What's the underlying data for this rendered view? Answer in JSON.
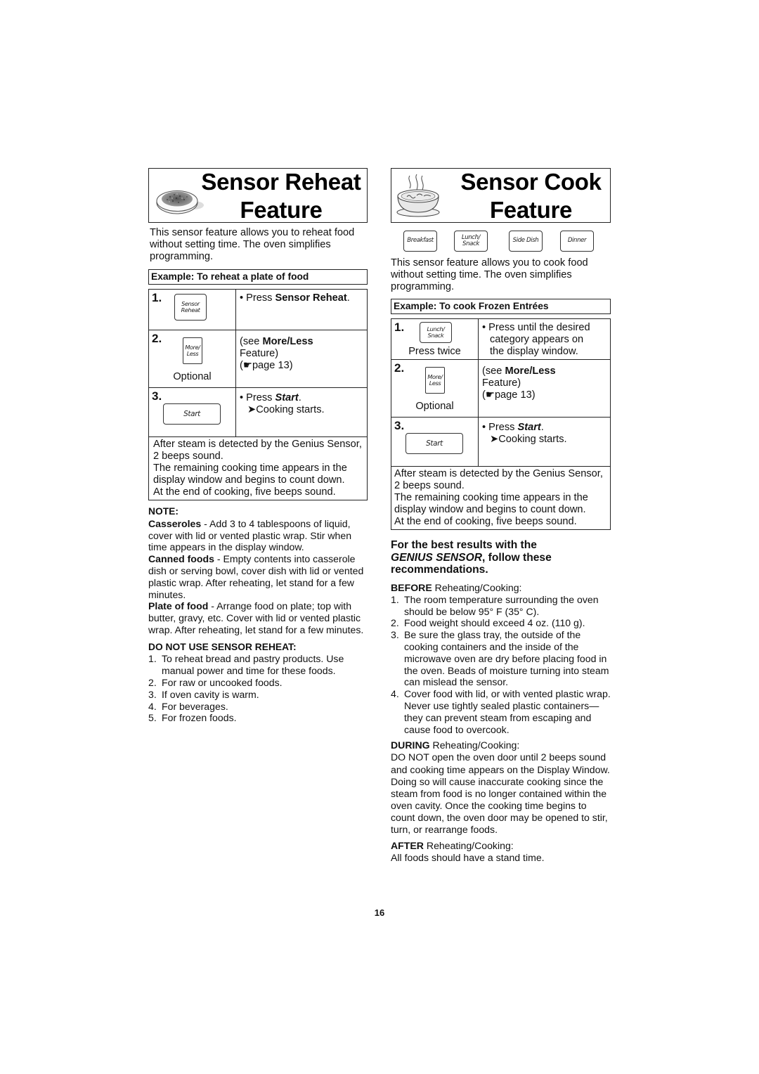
{
  "left": {
    "title_line1": "Sensor Reheat",
    "title_line2": "Feature",
    "title_art_icon": "plate-of-food-icon",
    "intro": "This sensor feature allows you to reheat food without setting time. The oven simplifies programming.",
    "example_title": "Example: To reheat a plate of food",
    "steps": [
      {
        "number": "1.",
        "pad_line1": "Sensor",
        "pad_line2": "Reheat",
        "sublabel": "",
        "text_prefix": "• Press ",
        "text_bold": "Sensor Reheat",
        "text_suffix": "."
      },
      {
        "number": "2.",
        "pad_line1": "More/",
        "pad_line2": "Less",
        "sublabel": "Optional",
        "text_prefix": "(see ",
        "text_bold": "More/Less",
        "text_line2": "Feature)",
        "text_line3": "(☛page 13)"
      },
      {
        "number": "3.",
        "pad_line1": "Start",
        "text_prefix": "• Press ",
        "text_bold": "Start",
        "text_suffix": ".",
        "text_line2": "➤Cooking starts."
      }
    ],
    "after_text": [
      "After steam is detected by the Genius Sensor, 2 beeps sound.",
      "The remaining cooking time appears in the display window and begins to count down.",
      "At the end of cooking, five beeps sound."
    ],
    "note": {
      "heading": "NOTE:",
      "items": [
        {
          "bold": "Casseroles",
          "text": " - Add 3 to 4 tablespoons of liquid, cover with lid or vented plastic wrap. Stir when time appears in the display window."
        },
        {
          "bold": "Canned foods",
          "text": " - Empty contents into casserole dish or serving bowl, cover dish with lid or vented plastic wrap. After reheating, let stand for a few minutes."
        },
        {
          "bold": "Plate of food",
          "text": " - Arrange food on plate; top with butter, gravy, etc. Cover with lid or vented plastic wrap. After reheating, let stand for a few minutes."
        }
      ]
    },
    "do_not_use": {
      "heading": "DO NOT USE SENSOR REHEAT:",
      "items": [
        {
          "n": "1.",
          "text": "To reheat bread and pastry products. Use manual power and time for these foods."
        },
        {
          "n": "2.",
          "text": "For raw or uncooked foods."
        },
        {
          "n": "3.",
          "text": "If oven cavity is warm."
        },
        {
          "n": "4.",
          "text": "For beverages."
        },
        {
          "n": "5.",
          "text": "For frozen foods."
        }
      ]
    }
  },
  "right": {
    "title_line1": "Sensor Cook",
    "title_line2": "Feature",
    "title_art_icon": "steaming-bowl-icon",
    "category_pads": [
      {
        "line1": "Breakfast",
        "line2": ""
      },
      {
        "line1": "Lunch/",
        "line2": "Snack"
      },
      {
        "line1": "Side Dish",
        "line2": ""
      },
      {
        "line1": "Dinner",
        "line2": ""
      }
    ],
    "intro": "This sensor feature allows you to cook food without setting time. The oven simplifies programming.",
    "example_title": "Example: To cook Frozen Entrées",
    "steps": [
      {
        "number": "1.",
        "pad_line1": "Lunch/",
        "pad_line2": "Snack",
        "sublabel": "Press twice",
        "text_prefix": "• Press until the desired",
        "text_line2": "category appears on",
        "text_line3": "the display window."
      },
      {
        "number": "2.",
        "pad_line1": "More/",
        "pad_line2": "Less",
        "sublabel": "Optional",
        "text_prefix": "(see ",
        "text_bold": "More/Less",
        "text_line2": "Feature)",
        "text_line3": "(☛page 13)"
      },
      {
        "number": "3.",
        "pad_line1": "Start",
        "text_prefix": "• Press ",
        "text_bold": "Start",
        "text_suffix": ".",
        "text_line2": "➤Cooking starts."
      }
    ],
    "after_text": [
      "After steam is detected by the Genius Sensor, 2 beeps sound.",
      "The remaining cooking time appears in the display window and begins to count down.",
      "At the end of cooking, five beeps sound."
    ],
    "best_results": {
      "line1": "For the best results with the",
      "italic": "GENIUS SENSOR",
      "rest": ", follow these recommendations."
    },
    "before": {
      "bold": "BEFORE",
      "label": " Reheating/Cooking:",
      "items": [
        {
          "n": "1.",
          "text": "The room temperature surrounding the oven should be below 95° F (35° C)."
        },
        {
          "n": "2.",
          "text": "Food weight should exceed 4 oz. (110 g)."
        },
        {
          "n": "3.",
          "text": "Be sure the glass tray, the outside of the cooking containers and the inside of the microwave oven are dry before placing food in the oven. Beads of moisture turning into steam can mislead the sensor."
        },
        {
          "n": "4.",
          "text": "Cover food with lid, or with vented plastic wrap. Never use tightly sealed plastic containers—they can prevent steam from escaping and cause food to overcook."
        }
      ]
    },
    "during": {
      "bold": "DURING",
      "label": " Reheating/Cooking:",
      "text": "DO NOT open the oven door until 2 beeps sound and cooking time appears on the Display Window.  Doing so will cause inaccurate cooking since the steam from food is no longer contained within the oven cavity. Once the cooking time begins to count down, the oven door may be opened to stir, turn, or rearrange foods."
    },
    "after": {
      "bold": "AFTER",
      "label": " Reheating/Cooking:",
      "text": "All foods should have a stand time."
    }
  },
  "page_number": "16"
}
